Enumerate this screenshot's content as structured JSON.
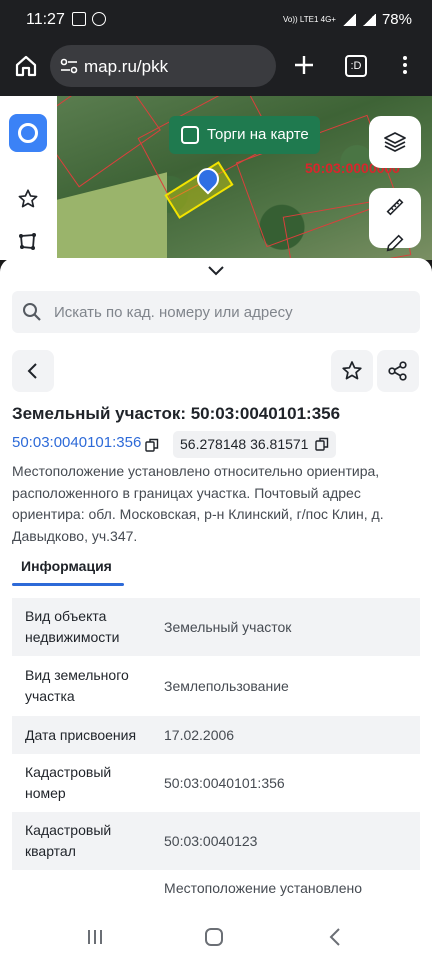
{
  "status": {
    "time": "11:27",
    "battery": "78%",
    "network": "Vo)) LTE1 4G+"
  },
  "browser": {
    "url": "map.ru/pkk",
    "tabs_label": ":D"
  },
  "map": {
    "torgi_label": "Торги на карте",
    "cadastral_label": "50:03:0000000"
  },
  "sheet": {
    "search_placeholder": "Искать по кад. номеру или адресу",
    "title": "Земельный участок: 50:03:0040101:356",
    "cad_number": "50:03:0040101:356",
    "coords": "56.278148 36.81571",
    "address": "Местоположение установлено относительно ориентира, расположенного в границах участка. Почтовый адрес ориентира: обл. Московская, р-н Клинский, г/пос Клин, д. Давыдково, уч.347.",
    "tab_info": "Информация",
    "rows": [
      {
        "key": "Вид объекта недвижимости",
        "value": "Земельный участок"
      },
      {
        "key": "Вид земельного участка",
        "value": "Землепользование"
      },
      {
        "key": "Дата присвоения",
        "value": "17.02.2006"
      },
      {
        "key": "Кадастровый номер",
        "value": "50:03:0040101:356"
      },
      {
        "key": "Кадастровый квартал",
        "value": "50:03:0040123"
      },
      {
        "key": "",
        "value": "Местоположение установлено"
      }
    ]
  },
  "colors": {
    "accent": "#2d6ad8",
    "torgi": "#1f7a4f",
    "parcel": "#f2e300",
    "cadastral_red": "#d8262c"
  }
}
